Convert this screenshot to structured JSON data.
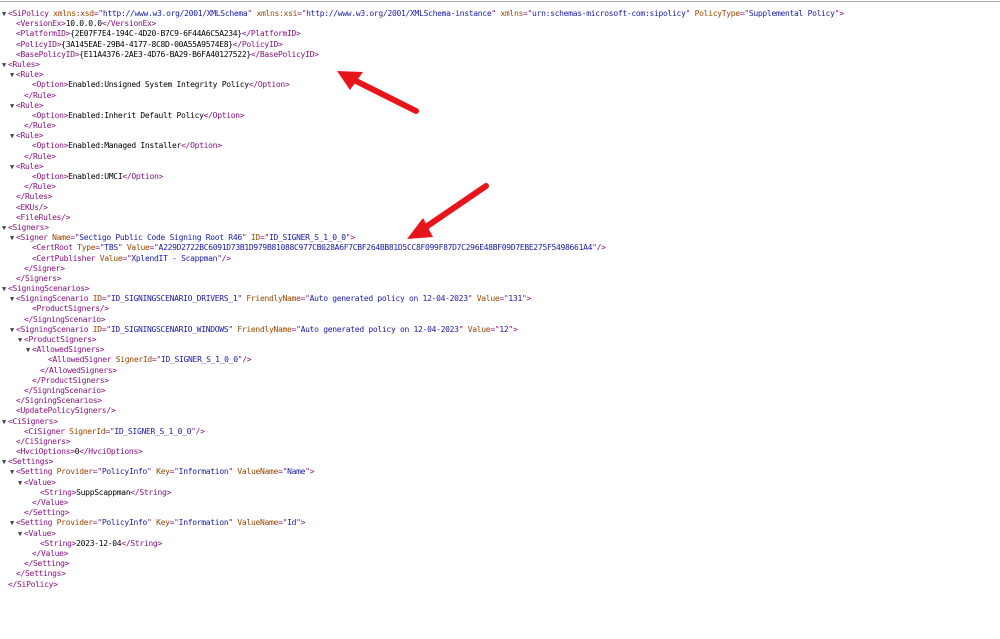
{
  "lines": [
    {
      "d": 0,
      "t": 1,
      "html": "<span class=\"tag\">&lt;SiPolicy </span><span class=\"an\">xmlns:xsd</span><span class=\"tag\">=\"</span><span class=\"av\">http://www.w3.org/2001/XMLSchema</span><span class=\"tag\">\" </span><span class=\"an\">xmlns:xsi</span><span class=\"tag\">=\"</span><span class=\"av\">http://www.w3.org/2001/XMLSchema-instance</span><span class=\"tag\">\" </span><span class=\"an\">xmlns</span><span class=\"tag\">=\"</span><span class=\"av\">urn:schemas-microsoft-com:sipolicy</span><span class=\"tag\">\" </span><span class=\"an\">PolicyType</span><span class=\"tag\">=\"</span><span class=\"av\">Supplemental Policy</span><span class=\"tag\">\"&gt;</span>"
    },
    {
      "d": 1,
      "t": 0,
      "html": "<span class=\"tag\">&lt;VersionEx&gt;</span><span class=\"tx\">10.0.0.0</span><span class=\"tag\">&lt;/VersionEx&gt;</span>"
    },
    {
      "d": 1,
      "t": 0,
      "html": "<span class=\"tag\">&lt;PlatformID&gt;</span><span class=\"tx\">{2E07F7E4-194C-4D20-B7C9-6F44A6C5A234}</span><span class=\"tag\">&lt;/PlatformID&gt;</span>"
    },
    {
      "d": 1,
      "t": 0,
      "html": "<span class=\"tag\">&lt;PolicyID&gt;</span><span class=\"tx\">{3A145EAE-29B4-4177-8C8D-00A55A9574E8}</span><span class=\"tag\">&lt;/PolicyID&gt;</span>"
    },
    {
      "d": 1,
      "t": 0,
      "html": "<span class=\"tag\">&lt;BasePolicyID&gt;</span><span class=\"tx\">{E11A4376-2AE3-4D76-BA29-B6FA40127522}</span><span class=\"tag\">&lt;/BasePolicyID&gt;</span>"
    },
    {
      "d": 0,
      "t": 1,
      "html": "<span class=\"tag\">&lt;Rules&gt;</span>"
    },
    {
      "d": 1,
      "t": 1,
      "html": "<span class=\"tag\">&lt;Rule&gt;</span>"
    },
    {
      "d": 3,
      "t": 0,
      "html": "<span class=\"tag\">&lt;Option&gt;</span><span class=\"tx\">Enabled:Unsigned System Integrity Policy</span><span class=\"tag\">&lt;/Option&gt;</span>"
    },
    {
      "d": 2,
      "t": 0,
      "html": "<span class=\"tag\">&lt;/Rule&gt;</span>"
    },
    {
      "d": 1,
      "t": 1,
      "html": "<span class=\"tag\">&lt;Rule&gt;</span>"
    },
    {
      "d": 3,
      "t": 0,
      "html": "<span class=\"tag\">&lt;Option&gt;</span><span class=\"tx\">Enabled:Inherit Default Policy</span><span class=\"tag\">&lt;/Option&gt;</span>"
    },
    {
      "d": 2,
      "t": 0,
      "html": "<span class=\"tag\">&lt;/Rule&gt;</span>"
    },
    {
      "d": 1,
      "t": 1,
      "html": "<span class=\"tag\">&lt;Rule&gt;</span>"
    },
    {
      "d": 3,
      "t": 0,
      "html": "<span class=\"tag\">&lt;Option&gt;</span><span class=\"tx\">Enabled:Managed Installer</span><span class=\"tag\">&lt;/Option&gt;</span>"
    },
    {
      "d": 2,
      "t": 0,
      "html": "<span class=\"tag\">&lt;/Rule&gt;</span>"
    },
    {
      "d": 1,
      "t": 1,
      "html": "<span class=\"tag\">&lt;Rule&gt;</span>"
    },
    {
      "d": 3,
      "t": 0,
      "html": "<span class=\"tag\">&lt;Option&gt;</span><span class=\"tx\">Enabled:UMCI</span><span class=\"tag\">&lt;/Option&gt;</span>"
    },
    {
      "d": 2,
      "t": 0,
      "html": "<span class=\"tag\">&lt;/Rule&gt;</span>"
    },
    {
      "d": 1,
      "t": 0,
      "html": "<span class=\"tag\">&lt;/Rules&gt;</span>"
    },
    {
      "d": 1,
      "t": 0,
      "html": "<span class=\"tag\">&lt;EKUs/&gt;</span>"
    },
    {
      "d": 1,
      "t": 0,
      "html": "<span class=\"tag\">&lt;FileRules/&gt;</span>"
    },
    {
      "d": 0,
      "t": 1,
      "html": "<span class=\"tag\">&lt;Signers&gt;</span>"
    },
    {
      "d": 1,
      "t": 1,
      "html": "<span class=\"tag\">&lt;Signer </span><span class=\"an\">Name</span><span class=\"tag\">=\"</span><span class=\"av\">Sectigo Public Code Signing Root R46</span><span class=\"tag\">\" </span><span class=\"an\">ID</span><span class=\"tag\">=\"</span><span class=\"av\">ID_SIGNER_S_1_0_0</span><span class=\"tag\">\"&gt;</span>"
    },
    {
      "d": 3,
      "t": 0,
      "html": "<span class=\"tag\">&lt;CertRoot </span><span class=\"an\">Type</span><span class=\"tag\">=\"</span><span class=\"av\">TBS</span><span class=\"tag\">\" </span><span class=\"an\">Value</span><span class=\"tag\">=\"</span><span class=\"av\">A229D2722BC6091D73B1D979B81088C977CB028A6F7CBF264BB81D5CC8F099F87D7C296E48BF09D7EBE275F5498661A4</span><span class=\"tag\">\"/&gt;</span>"
    },
    {
      "d": 3,
      "t": 0,
      "html": "<span class=\"tag\">&lt;CertPublisher </span><span class=\"an\">Value</span><span class=\"tag\">=\"</span><span class=\"av\">XplendIT - Scappman</span><span class=\"tag\">\"/&gt;</span>"
    },
    {
      "d": 2,
      "t": 0,
      "html": "<span class=\"tag\">&lt;/Signer&gt;</span>"
    },
    {
      "d": 1,
      "t": 0,
      "html": "<span class=\"tag\">&lt;/Signers&gt;</span>"
    },
    {
      "d": 0,
      "t": 1,
      "html": "<span class=\"tag\">&lt;SigningScenarios&gt;</span>"
    },
    {
      "d": 1,
      "t": 1,
      "html": "<span class=\"tag\">&lt;SigningScenario </span><span class=\"an\">ID</span><span class=\"tag\">=\"</span><span class=\"av\">ID_SIGNINGSCENARIO_DRIVERS_1</span><span class=\"tag\">\" </span><span class=\"an\">FriendlyName</span><span class=\"tag\">=\"</span><span class=\"av\">Auto generated policy on 12-04-2023</span><span class=\"tag\">\" </span><span class=\"an\">Value</span><span class=\"tag\">=\"</span><span class=\"av\">131</span><span class=\"tag\">\"&gt;</span>"
    },
    {
      "d": 3,
      "t": 0,
      "html": "<span class=\"tag\">&lt;ProductSigners/&gt;</span>"
    },
    {
      "d": 2,
      "t": 0,
      "html": "<span class=\"tag\">&lt;/SigningScenario&gt;</span>"
    },
    {
      "d": 1,
      "t": 1,
      "html": "<span class=\"tag\">&lt;SigningScenario </span><span class=\"an\">ID</span><span class=\"tag\">=\"</span><span class=\"av\">ID_SIGNINGSCENARIO_WINDOWS</span><span class=\"tag\">\" </span><span class=\"an\">FriendlyName</span><span class=\"tag\">=\"</span><span class=\"av\">Auto generated policy on 12-04-2023</span><span class=\"tag\">\" </span><span class=\"an\">Value</span><span class=\"tag\">=\"</span><span class=\"av\">12</span><span class=\"tag\">\"&gt;</span>"
    },
    {
      "d": 2,
      "t": 1,
      "html": "<span class=\"tag\">&lt;ProductSigners&gt;</span>"
    },
    {
      "d": 3,
      "t": 1,
      "html": "<span class=\"tag\">&lt;AllowedSigners&gt;</span>"
    },
    {
      "d": 5,
      "t": 0,
      "html": "<span class=\"tag\">&lt;AllowedSigner </span><span class=\"an\">SignerId</span><span class=\"tag\">=\"</span><span class=\"av\">ID_SIGNER_S_1_0_0</span><span class=\"tag\">\"/&gt;</span>"
    },
    {
      "d": 4,
      "t": 0,
      "html": "<span class=\"tag\">&lt;/AllowedSigners&gt;</span>"
    },
    {
      "d": 3,
      "t": 0,
      "html": "<span class=\"tag\">&lt;/ProductSigners&gt;</span>"
    },
    {
      "d": 2,
      "t": 0,
      "html": "<span class=\"tag\">&lt;/SigningScenario&gt;</span>"
    },
    {
      "d": 1,
      "t": 0,
      "html": "<span class=\"tag\">&lt;/SigningScenarios&gt;</span>"
    },
    {
      "d": 1,
      "t": 0,
      "html": "<span class=\"tag\">&lt;UpdatePolicySigners/&gt;</span>"
    },
    {
      "d": 0,
      "t": 1,
      "html": "<span class=\"tag\">&lt;CiSigners&gt;</span>"
    },
    {
      "d": 2,
      "t": 0,
      "html": "<span class=\"tag\">&lt;CiSigner </span><span class=\"an\">SignerId</span><span class=\"tag\">=\"</span><span class=\"av\">ID_SIGNER_S_1_0_0</span><span class=\"tag\">\"/&gt;</span>"
    },
    {
      "d": 1,
      "t": 0,
      "html": "<span class=\"tag\">&lt;/CiSigners&gt;</span>"
    },
    {
      "d": 1,
      "t": 0,
      "html": "<span class=\"tag\">&lt;HvciOptions&gt;</span><span class=\"tx\">0</span><span class=\"tag\">&lt;/HvciOptions&gt;</span>"
    },
    {
      "d": 0,
      "t": 1,
      "html": "<span class=\"tag\">&lt;Settings&gt;</span>"
    },
    {
      "d": 1,
      "t": 1,
      "html": "<span class=\"tag\">&lt;Setting </span><span class=\"an\">Provider</span><span class=\"tag\">=\"</span><span class=\"av\">PolicyInfo</span><span class=\"tag\">\" </span><span class=\"an\">Key</span><span class=\"tag\">=\"</span><span class=\"av\">Information</span><span class=\"tag\">\" </span><span class=\"an\">ValueName</span><span class=\"tag\">=\"</span><span class=\"av\">Name</span><span class=\"tag\">\"&gt;</span>"
    },
    {
      "d": 2,
      "t": 1,
      "html": "<span class=\"tag\">&lt;Value&gt;</span>"
    },
    {
      "d": 4,
      "t": 0,
      "html": "<span class=\"tag\">&lt;String&gt;</span><span class=\"tx\">SuppScappman</span><span class=\"tag\">&lt;/String&gt;</span>"
    },
    {
      "d": 3,
      "t": 0,
      "html": "<span class=\"tag\">&lt;/Value&gt;</span>"
    },
    {
      "d": 2,
      "t": 0,
      "html": "<span class=\"tag\">&lt;/Setting&gt;</span>"
    },
    {
      "d": 1,
      "t": 1,
      "html": "<span class=\"tag\">&lt;Setting </span><span class=\"an\">Provider</span><span class=\"tag\">=\"</span><span class=\"av\">PolicyInfo</span><span class=\"tag\">\" </span><span class=\"an\">Key</span><span class=\"tag\">=\"</span><span class=\"av\">Information</span><span class=\"tag\">\" </span><span class=\"an\">ValueName</span><span class=\"tag\">=\"</span><span class=\"av\">Id</span><span class=\"tag\">\"&gt;</span>"
    },
    {
      "d": 2,
      "t": 1,
      "html": "<span class=\"tag\">&lt;Value&gt;</span>"
    },
    {
      "d": 4,
      "t": 0,
      "html": "<span class=\"tag\">&lt;String&gt;</span><span class=\"tx\">2023-12-04</span><span class=\"tag\">&lt;/String&gt;</span>"
    },
    {
      "d": 3,
      "t": 0,
      "html": "<span class=\"tag\">&lt;/Value&gt;</span>"
    },
    {
      "d": 2,
      "t": 0,
      "html": "<span class=\"tag\">&lt;/Setting&gt;</span>"
    },
    {
      "d": 1,
      "t": 0,
      "html": "<span class=\"tag\">&lt;/Settings&gt;</span>"
    },
    {
      "d": 0,
      "t": 0,
      "html": "<span class=\"tag\">&lt;/SiPolicy&gt;</span>"
    }
  ],
  "colors": {
    "tag": "#881280",
    "attr_name": "#994500",
    "attr_value": "#1a1aa6",
    "arrow": "#e8141b"
  }
}
